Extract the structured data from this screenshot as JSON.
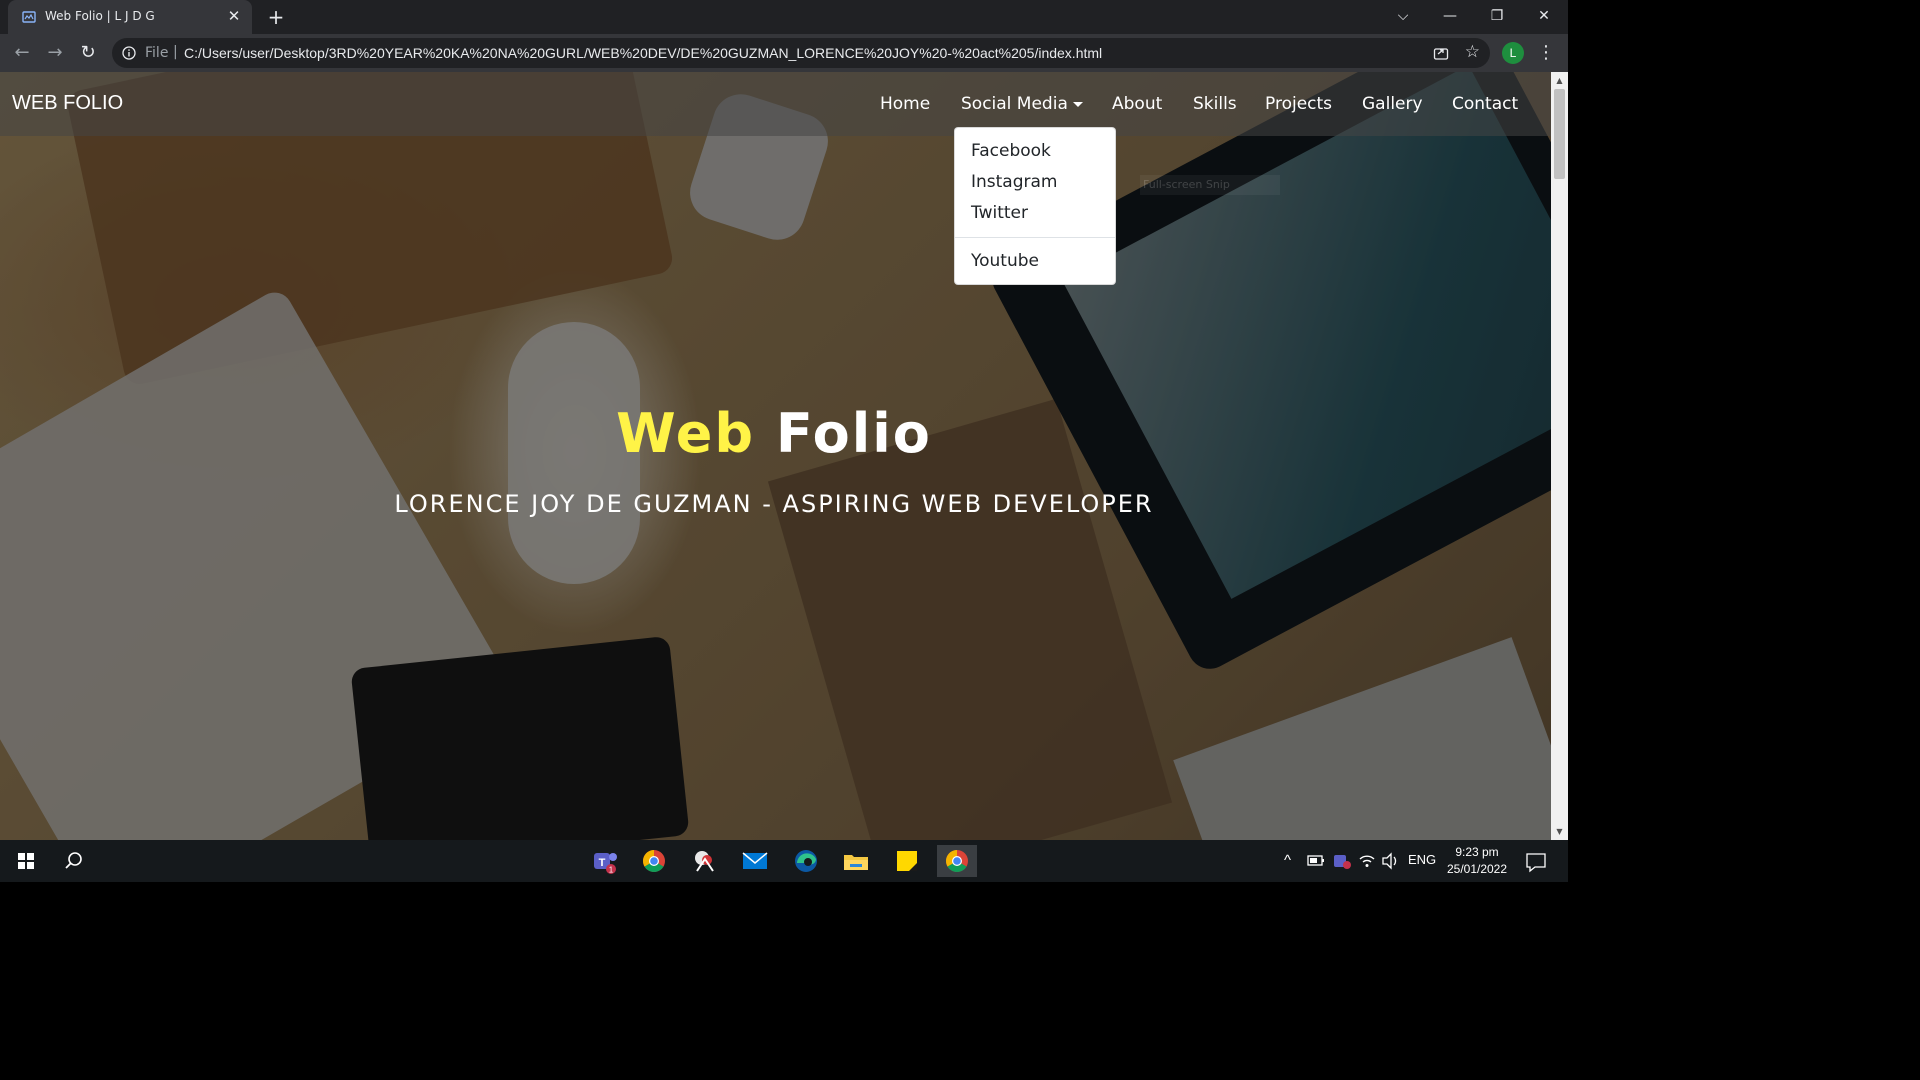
{
  "browser": {
    "tab": {
      "title": "Web Folio | L J D G",
      "close": "✕"
    },
    "new_tab": "+",
    "window_controls": {
      "tabsearch": "⌵",
      "minimize": "—",
      "restore": "❐",
      "close": "✕"
    },
    "nav": {
      "back": "←",
      "forward": "→",
      "reload": "↻"
    },
    "address": {
      "scheme": "File",
      "separator": "|",
      "url": "C:/Users/user/Desktop/3RD%20YEAR%20KA%20NA%20GURL/WEB%20DEV/DE%20GUZMAN_LORENCE%20JOY%20-%20act%205/index.html",
      "star": "☆"
    },
    "profile_initial": "L",
    "menu": "⋮"
  },
  "site": {
    "brand": "WEB FOLIO",
    "nav": [
      {
        "label": "Home"
      },
      {
        "label": "Social Media"
      },
      {
        "label": "About"
      },
      {
        "label": "Skills"
      },
      {
        "label": "Projects"
      },
      {
        "label": "Gallery"
      },
      {
        "label": "Contact"
      }
    ],
    "dropdown": [
      "Facebook",
      "Instagram",
      "Twitter",
      "Youtube"
    ],
    "snip_hint": "Full-screen Snip",
    "hero": {
      "title_part1": "Web",
      "title_part2": "Folio",
      "subtitle": "LORENCE JOY DE GUZMAN - ASPIRING WEB DEVELOPER"
    },
    "colors": {
      "title_accent": "#fff347",
      "nav_bg": "rgba(70,70,70,0.55)"
    }
  },
  "scrollbar": {
    "up": "▲",
    "down": "▼"
  },
  "taskbar": {
    "teams_badge": "1",
    "tray": {
      "chevron": "^",
      "language": "ENG"
    },
    "clock": {
      "time": "9:23 pm",
      "date": "25/01/2022"
    }
  }
}
